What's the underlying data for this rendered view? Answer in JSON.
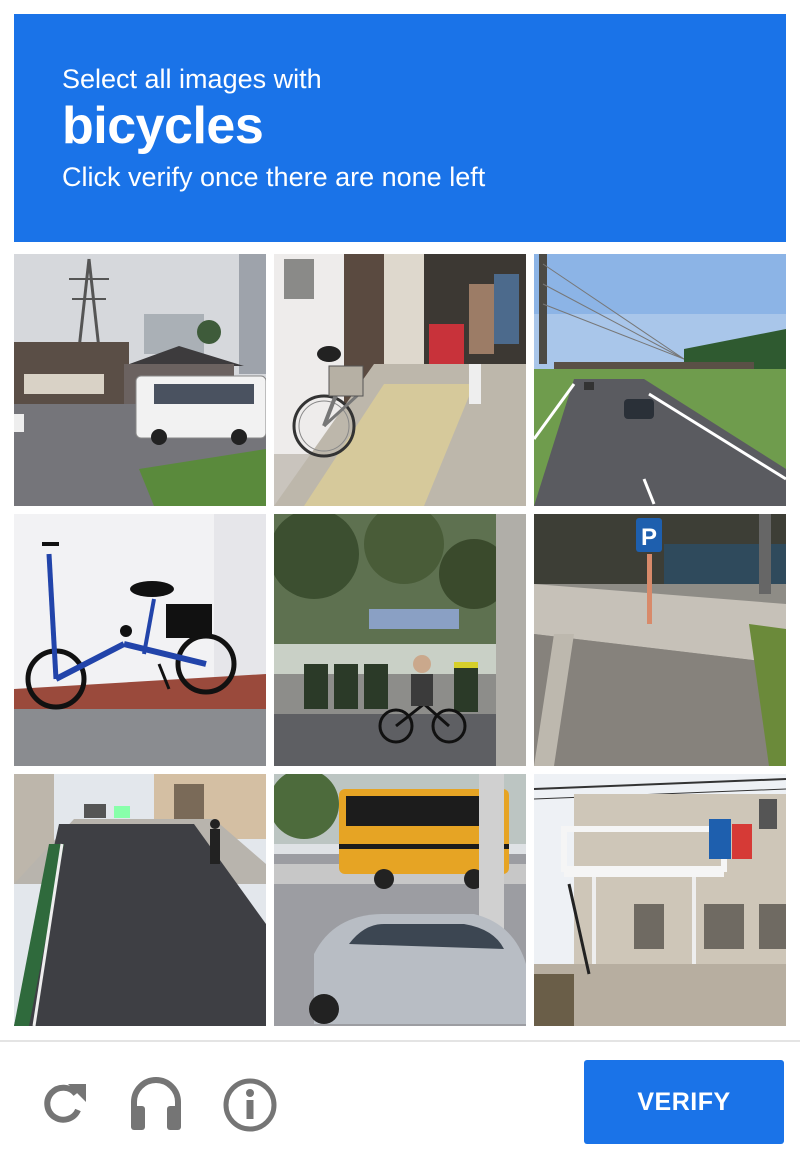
{
  "header": {
    "instruction": "Select all images with",
    "target": "bicycles",
    "subinstruction": "Click verify once there are none left"
  },
  "grid": {
    "tiles": [
      {
        "scene": "street with white minibus, power pylon and buildings"
      },
      {
        "scene": "bicycle parked in front of shop on sidewalk"
      },
      {
        "scene": "highway with cars and cable-stayed bridge"
      },
      {
        "scene": "blue folding bicycle against white wall"
      },
      {
        "scene": "person riding bicycle past trees and bins"
      },
      {
        "scene": "cobblestone sidewalk with blue parking sign"
      },
      {
        "scene": "narrow residential street with pedestrian"
      },
      {
        "scene": "yellow school bus and silver car"
      },
      {
        "scene": "two-story building with balcony and signs"
      }
    ]
  },
  "footer": {
    "reload_icon": "reload-icon",
    "audio_icon": "headphones-icon",
    "info_icon": "info-icon",
    "verify_label": "VERIFY"
  },
  "colors": {
    "accent": "#1a73e8",
    "icon_gray": "#757575"
  }
}
